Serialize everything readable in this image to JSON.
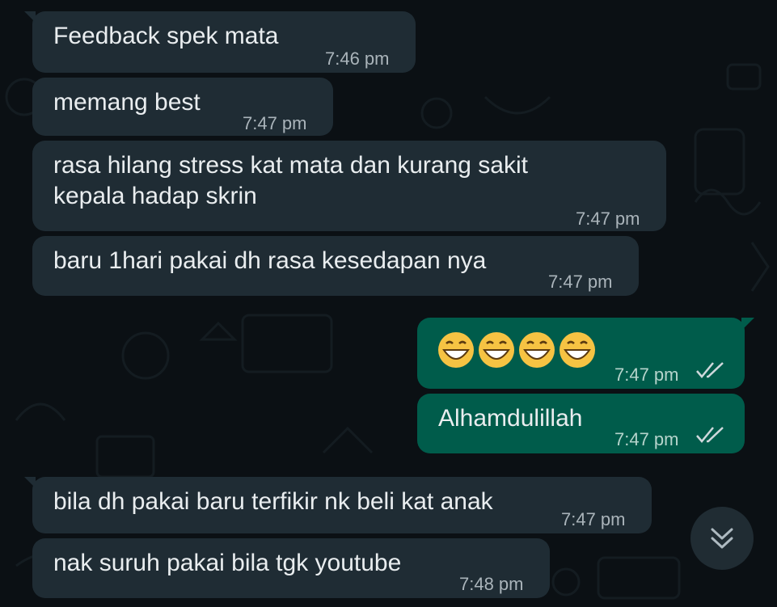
{
  "messages": [
    {
      "direction": "in",
      "text": "Feedback spek mata",
      "time": "7:46 pm"
    },
    {
      "direction": "in",
      "text": "memang best",
      "time": "7:47 pm"
    },
    {
      "direction": "in",
      "text": "rasa hilang stress kat mata dan kurang sakit\nkepala hadap skrin",
      "time": "7:47 pm"
    },
    {
      "direction": "in",
      "text": "baru 1hari pakai dh rasa kesedapan nya",
      "time": "7:47 pm"
    },
    {
      "direction": "out",
      "text": "😁😁😁😁",
      "time": "7:47 pm",
      "status": "read"
    },
    {
      "direction": "out",
      "text": "Alhamdulillah",
      "time": "7:47 pm",
      "status": "read"
    },
    {
      "direction": "in",
      "text": "bila dh pakai baru terfikir nk beli kat anak",
      "time": "7:47 pm"
    },
    {
      "direction": "in",
      "text": "nak suruh pakai bila tgk youtube",
      "time": "7:48 pm"
    }
  ],
  "scroll_button": {
    "icon": "double-chevron-down-icon"
  },
  "colors": {
    "background": "#0b1014",
    "incoming_bubble": "#1f2c34",
    "outgoing_bubble": "#005c4b",
    "tick_color": "#cfd8dc"
  }
}
